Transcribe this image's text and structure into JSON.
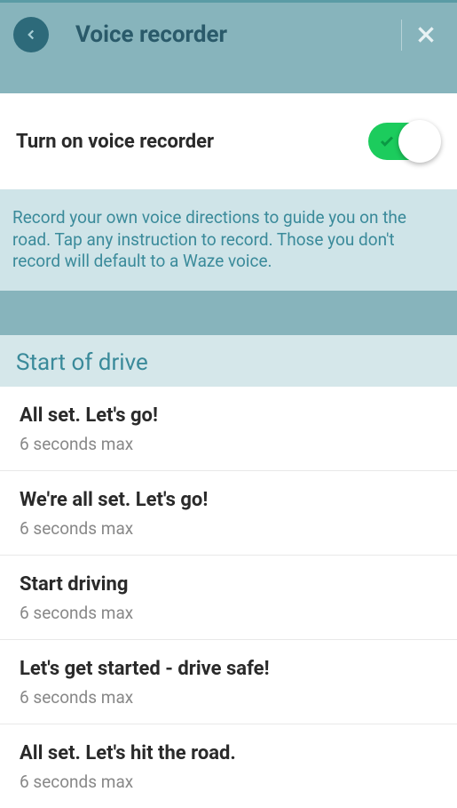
{
  "header": {
    "title": "Voice recorder"
  },
  "toggle": {
    "label": "Turn on voice recorder"
  },
  "info": {
    "text": "Record your own voice directions to guide you on the road. Tap any instruction to record. Those you don't record will default to a Waze voice."
  },
  "section": {
    "title": "Start of drive"
  },
  "items": [
    {
      "title": "All set. Let's go!",
      "subtitle": "6 seconds max"
    },
    {
      "title": "We're all set. Let's go!",
      "subtitle": "6 seconds max"
    },
    {
      "title": "Start driving",
      "subtitle": "6 seconds max"
    },
    {
      "title": "Let's get started - drive safe!",
      "subtitle": "6 seconds max"
    },
    {
      "title": "All set. Let's hit the road.",
      "subtitle": "6 seconds max"
    }
  ]
}
